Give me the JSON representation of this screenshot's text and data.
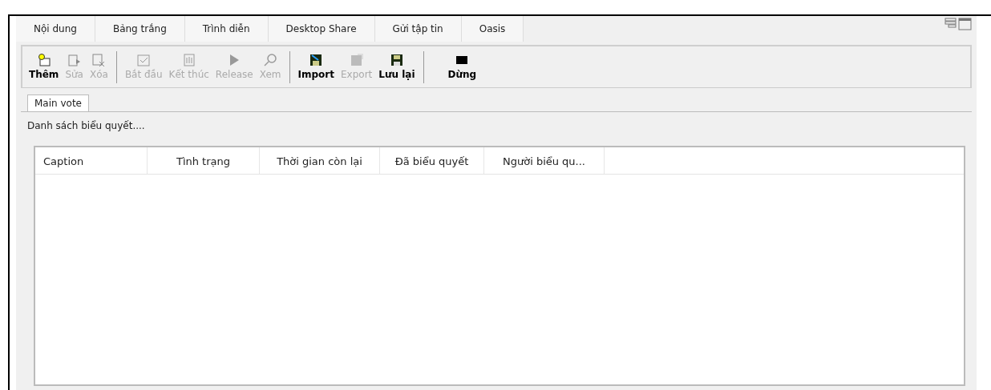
{
  "tabs": [
    {
      "label": "Nội dung",
      "selected": false
    },
    {
      "label": "Bảng trắng",
      "selected": false
    },
    {
      "label": "Trình diễn",
      "selected": false
    },
    {
      "label": "Desktop Share",
      "selected": false
    },
    {
      "label": "Gửi tập tin",
      "selected": false
    },
    {
      "label": "Oasis",
      "selected": false
    }
  ],
  "toolbar_groups": [
    {
      "buttons": [
        {
          "label": "Thêm",
          "disabled": false
        },
        {
          "label": "Sửa",
          "disabled": true
        },
        {
          "label": "Xóa",
          "disabled": true
        }
      ]
    },
    {
      "buttons": [
        {
          "label": "Bắt đầu",
          "disabled": true
        },
        {
          "label": "Kết thúc",
          "disabled": true
        },
        {
          "label": "Release",
          "disabled": true
        },
        {
          "label": "Xem",
          "disabled": true
        }
      ]
    },
    {
      "buttons": [
        {
          "label": "Import",
          "disabled": false
        },
        {
          "label": "Export",
          "disabled": true
        },
        {
          "label": "Lưu lại",
          "disabled": false
        }
      ]
    },
    {
      "buttons": [
        {
          "label": "Dừng",
          "disabled": false
        }
      ]
    }
  ],
  "inner_tabs": [
    {
      "label": "Main vote",
      "selected": true
    }
  ],
  "list_label": "Danh sách biểu quyết....",
  "table": {
    "columns": [
      "Caption",
      "Tình trạng",
      "Thời gian còn lại",
      "Đã biểu quyết",
      "Người biểu qu..."
    ]
  }
}
